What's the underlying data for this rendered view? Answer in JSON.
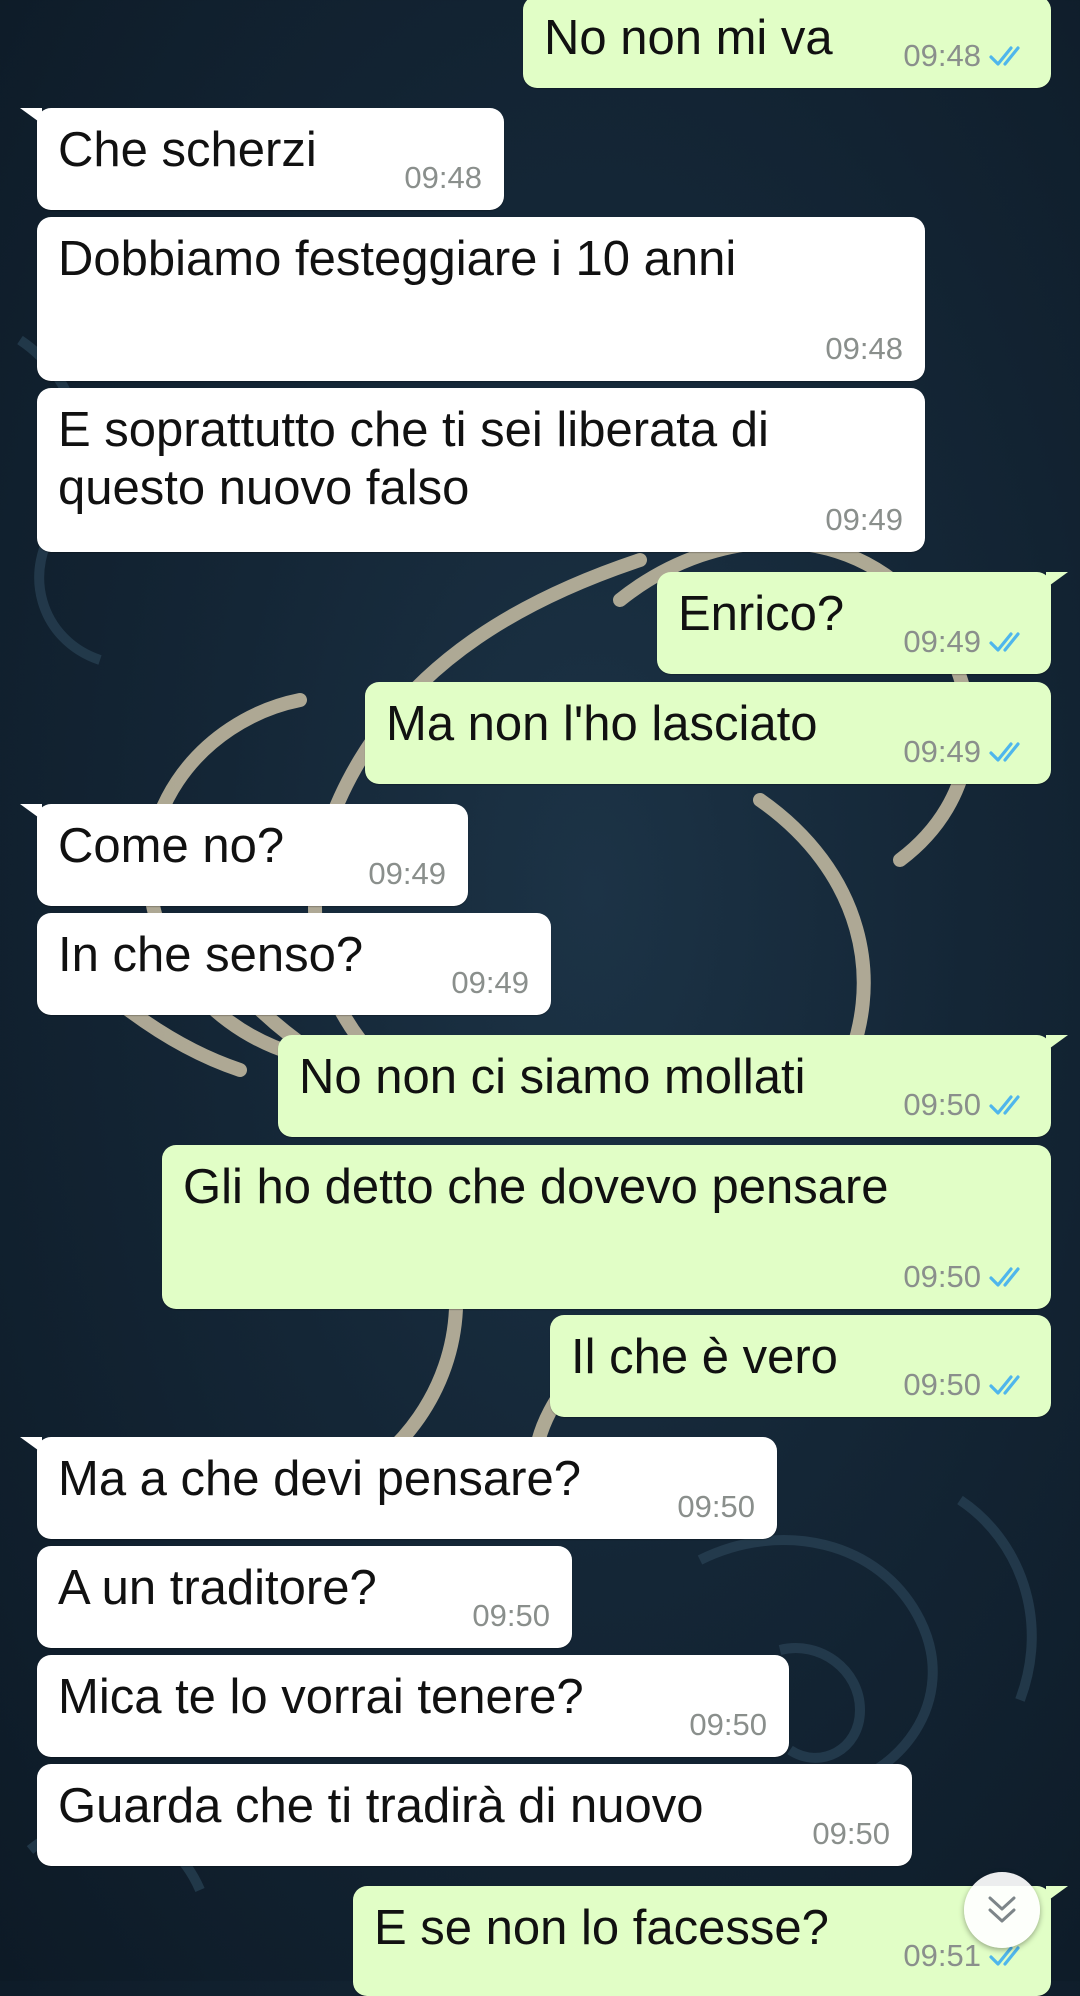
{
  "chat": {
    "messages": [
      {
        "dir": "out",
        "text": "No non mi va",
        "time": "09:48",
        "read": true
      },
      {
        "dir": "in",
        "text": "Che scherzi",
        "time": "09:48"
      },
      {
        "dir": "in",
        "text": "Dobbiamo festeggiare i 10 anni",
        "time": "09:48"
      },
      {
        "dir": "in",
        "text": "E soprattutto che ti sei liberata di\nquesto nuovo falso",
        "time": "09:49"
      },
      {
        "dir": "out",
        "text": "Enrico?",
        "time": "09:49",
        "read": true
      },
      {
        "dir": "out",
        "text": "Ma non l'ho lasciato",
        "time": "09:49",
        "read": true
      },
      {
        "dir": "in",
        "text": "Come no?",
        "time": "09:49"
      },
      {
        "dir": "in",
        "text": "In che senso?",
        "time": "09:49"
      },
      {
        "dir": "out",
        "text": "No non ci siamo mollati",
        "time": "09:50",
        "read": true
      },
      {
        "dir": "out",
        "text": "Gli ho detto che dovevo pensare",
        "time": "09:50",
        "read": true
      },
      {
        "dir": "out",
        "text": "Il che è vero",
        "time": "09:50",
        "read": true
      },
      {
        "dir": "in",
        "text": "Ma a che devi pensare?",
        "time": "09:50"
      },
      {
        "dir": "in",
        "text": "A un traditore?",
        "time": "09:50"
      },
      {
        "dir": "in",
        "text": "Mica te lo vorrai tenere?",
        "time": "09:50"
      },
      {
        "dir": "in",
        "text": "Guarda che ti tradirà di nuovo",
        "time": "09:50"
      },
      {
        "dir": "out",
        "text": "E se non lo facesse?",
        "time": "09:51",
        "read": true
      }
    ]
  },
  "scroll_down_button": {
    "icon": "double-chevron-down-icon"
  },
  "colors": {
    "incoming_bubble": "#ffffff",
    "outgoing_bubble": "#e1fec6",
    "read_receipt": "#4fb6ec",
    "timestamp": "#8a8f8c",
    "wallpaper": "#142636"
  }
}
